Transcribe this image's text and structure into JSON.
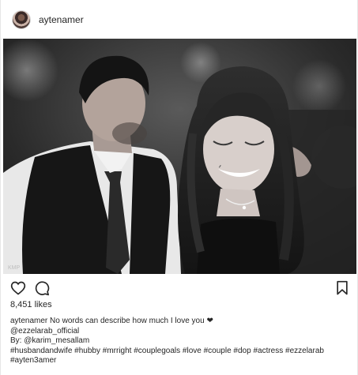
{
  "post": {
    "username": "aytenamer",
    "likes_text": "8,451 likes",
    "caption": {
      "username": "aytenamer",
      "text": "No words can describe how much I love you ❤",
      "mention": "@ezzelarab_official",
      "by_line": "By: @karim_mesallam",
      "hashtags": "#husbandandwife #hubby #mrright #couplegoals #love #couple #dop #actress #ezzelarab #ayten3amer"
    },
    "photo_watermark": "KMP"
  },
  "icons": {
    "like": "heart-outline-icon",
    "comment": "comment-bubble-icon",
    "save": "bookmark-icon"
  }
}
